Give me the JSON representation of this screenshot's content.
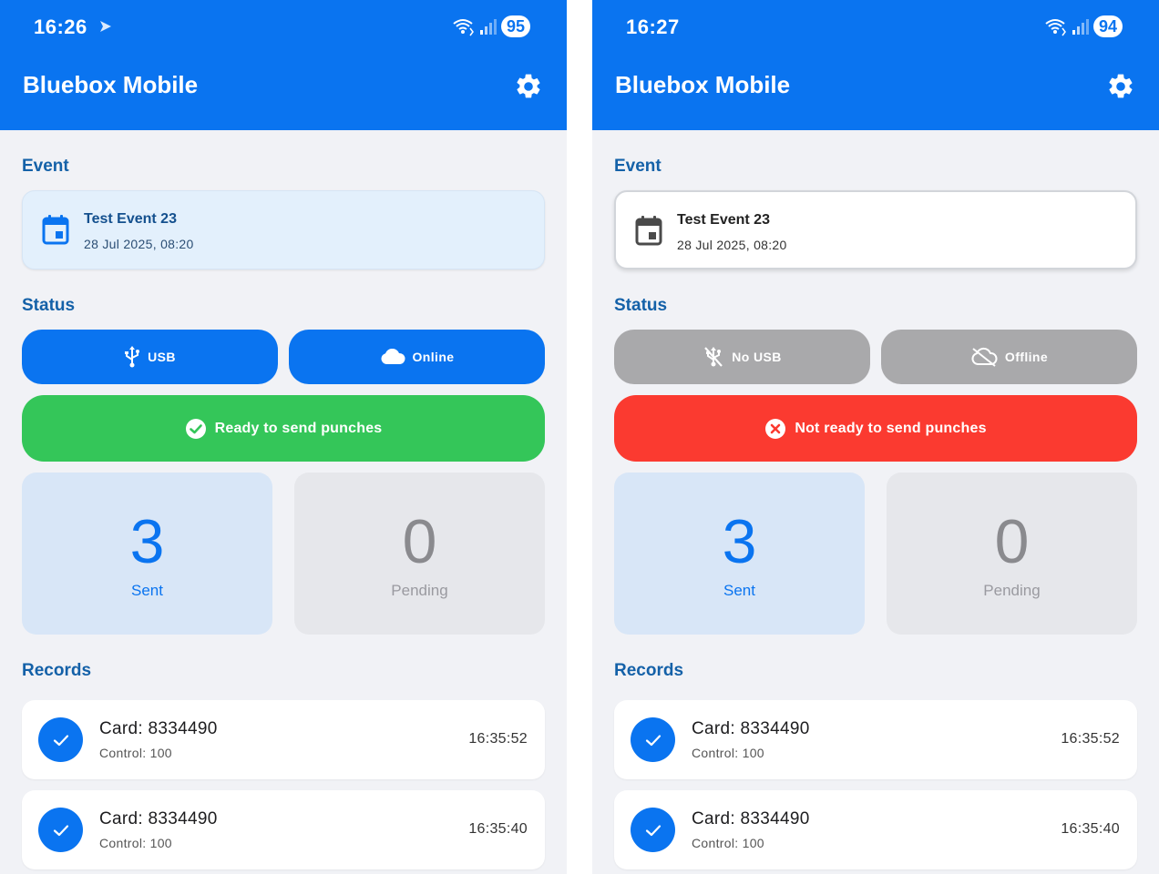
{
  "screens": [
    {
      "status_bar": {
        "time": "16:26",
        "battery": "95"
      },
      "app_title": "Bluebox Mobile",
      "event_label": "Event",
      "event": {
        "name": "Test Event 23",
        "date": "28 Jul 2025, 08:20"
      },
      "status_label": "Status",
      "usb_label": "USB",
      "cloud_label": "Online",
      "banner": "Ready to send punches",
      "sent": {
        "count": "3",
        "label": "Sent"
      },
      "pending": {
        "count": "0",
        "label": "Pending"
      },
      "records_label": "Records",
      "records": [
        {
          "card": "Card: 8334490",
          "control": "Control: 100",
          "time": "16:35:52"
        },
        {
          "card": "Card: 8334490",
          "control": "Control: 100",
          "time": "16:35:40"
        }
      ]
    },
    {
      "status_bar": {
        "time": "16:27",
        "battery": "94"
      },
      "app_title": "Bluebox Mobile",
      "event_label": "Event",
      "event": {
        "name": "Test Event 23",
        "date": "28 Jul 2025, 08:20"
      },
      "status_label": "Status",
      "usb_label": "No USB",
      "cloud_label": "Offline",
      "banner": "Not ready to send punches",
      "sent": {
        "count": "3",
        "label": "Sent"
      },
      "pending": {
        "count": "0",
        "label": "Pending"
      },
      "records_label": "Records",
      "records": [
        {
          "card": "Card: 8334490",
          "control": "Control: 100",
          "time": "16:35:52"
        },
        {
          "card": "Card: 8334490",
          "control": "Control: 100",
          "time": "16:35:40"
        }
      ]
    }
  ],
  "colors": {
    "primary": "#0a74f0",
    "ready": "#34c659",
    "not_ready": "#fb3a30",
    "disabled": "#a9a9ab",
    "heading": "#1461a8"
  }
}
